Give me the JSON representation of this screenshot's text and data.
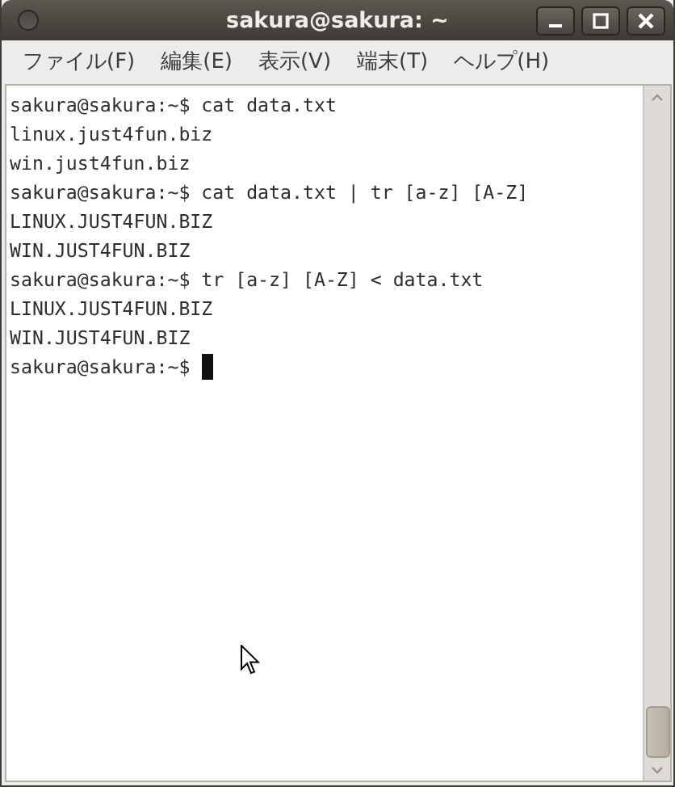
{
  "window": {
    "title": "sakura@sakura: ~"
  },
  "menu": [
    {
      "label": "ファイル(F)"
    },
    {
      "label": "編集(E)"
    },
    {
      "label": "表示(V)"
    },
    {
      "label": "端末(T)"
    },
    {
      "label": "ヘルプ(H)"
    }
  ],
  "terminal": {
    "lines": [
      {
        "kind": "prompt",
        "prompt": "sakura@sakura:~$",
        "command": "cat data.txt",
        "cursor": false
      },
      {
        "kind": "output",
        "text": "linux.just4fun.biz"
      },
      {
        "kind": "output",
        "text": "win.just4fun.biz"
      },
      {
        "kind": "prompt",
        "prompt": "sakura@sakura:~$",
        "command": "cat data.txt | tr [a-z] [A-Z]",
        "cursor": false
      },
      {
        "kind": "output",
        "text": "LINUX.JUST4FUN.BIZ"
      },
      {
        "kind": "output",
        "text": "WIN.JUST4FUN.BIZ"
      },
      {
        "kind": "prompt",
        "prompt": "sakura@sakura:~$",
        "command": "tr [a-z] [A-Z] < data.txt",
        "cursor": false
      },
      {
        "kind": "output",
        "text": "LINUX.JUST4FUN.BIZ"
      },
      {
        "kind": "output",
        "text": "WIN.JUST4FUN.BIZ"
      },
      {
        "kind": "prompt",
        "prompt": "sakura@sakura:~$",
        "cursor": true
      }
    ]
  }
}
